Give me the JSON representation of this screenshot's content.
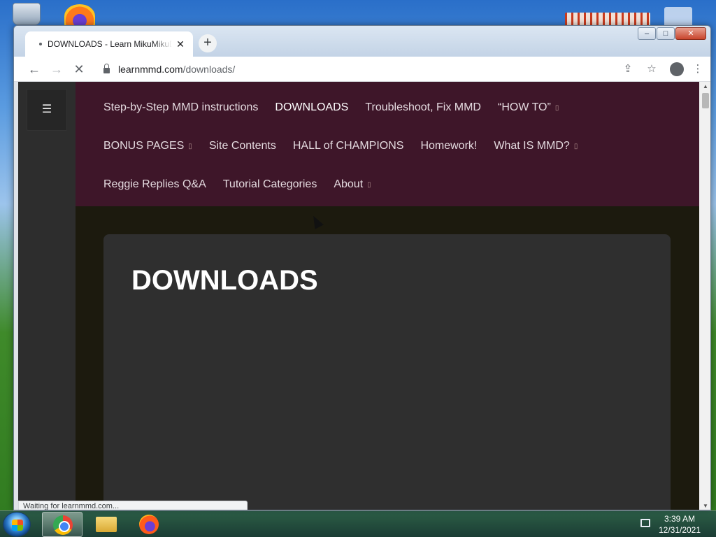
{
  "browser": {
    "tab_title": "DOWNLOADS - Learn MikuMikuDance",
    "tab_close": "✕",
    "new_tab": "+",
    "url_host": "learnmmd.com",
    "url_path": "/downloads/",
    "status_text": "Waiting for learnmmd.com...",
    "window_controls": {
      "minimize": "–",
      "maximize": "□",
      "close": "✕"
    },
    "icons": {
      "back": "←",
      "forward": "→",
      "stop": "✕",
      "share": "⇪",
      "bookmark": "☆",
      "menu": "⋮"
    }
  },
  "site": {
    "menu_toggle": "☰",
    "nav_rows": [
      [
        {
          "label": "Step-by-Step MMD instructions",
          "active": false,
          "dropdown": false
        },
        {
          "label": "DOWNLOADS",
          "active": true,
          "dropdown": false
        },
        {
          "label": "Troubleshoot, Fix MMD",
          "active": false,
          "dropdown": false
        },
        {
          "label": "“HOW TO”",
          "active": false,
          "dropdown": true
        }
      ],
      [
        {
          "label": "BONUS PAGES",
          "active": false,
          "dropdown": true
        },
        {
          "label": "Site Contents",
          "active": false,
          "dropdown": false
        },
        {
          "label": "HALL of CHAMPIONS",
          "active": false,
          "dropdown": false
        },
        {
          "label": "Homework!",
          "active": false,
          "dropdown": false
        },
        {
          "label": "What IS MMD?",
          "active": false,
          "dropdown": true
        }
      ],
      [
        {
          "label": "Reggie Replies Q&A",
          "active": false,
          "dropdown": false
        },
        {
          "label": "Tutorial Categories",
          "active": false,
          "dropdown": false
        },
        {
          "label": "About",
          "active": false,
          "dropdown": true
        }
      ]
    ],
    "dropdown_caret": "▯",
    "page_title": "DOWNLOADS"
  },
  "taskbar": {
    "time": "3:39 AM",
    "date": "12/31/2021"
  }
}
